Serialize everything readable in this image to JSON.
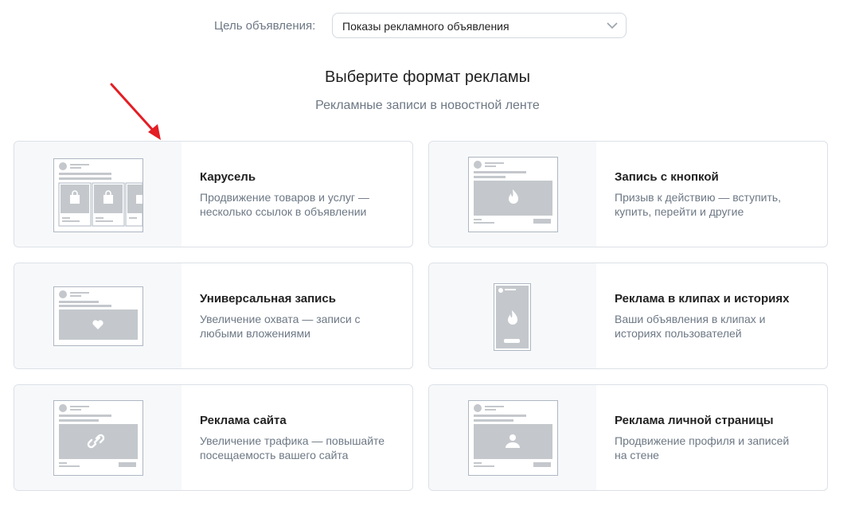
{
  "goal": {
    "label": "Цель объявления:",
    "selected": "Показы рекламного объявления"
  },
  "heading": {
    "title": "Выберите формат рекламы",
    "subtitle": "Рекламные записи в новостной ленте"
  },
  "colors": {
    "annotation_arrow": "#e31e24",
    "placeholder_gray": "#c4c8cc",
    "card_border": "#dce1e6"
  },
  "formats": [
    {
      "title": "Карусель",
      "desc1": "Продвижение товаров и услуг —",
      "desc2": "несколько ссылок в объявлении",
      "icon": "shopping-bag-icon"
    },
    {
      "title": "Запись с кнопкой",
      "desc1": "Призыв к действию — вступить,",
      "desc2": "купить, перейти и другие",
      "icon": "flame-icon"
    },
    {
      "title": "Универсальная запись",
      "desc1": "Увеличение охвата — записи с",
      "desc2": "любыми вложениями",
      "icon": "heart-icon"
    },
    {
      "title": "Реклама в клипах и историях",
      "desc1": "Ваши объявления в клипах и",
      "desc2": "историях пользователей",
      "icon": "flame-icon"
    },
    {
      "title": "Реклама сайта",
      "desc1": "Увеличение трафика — повышайте",
      "desc2": "посещаемость вашего сайта",
      "icon": "link-icon"
    },
    {
      "title": "Реклама личной страницы",
      "desc1": "Продвижение профиля и записей",
      "desc2": "на стене",
      "icon": "user-icon"
    }
  ]
}
